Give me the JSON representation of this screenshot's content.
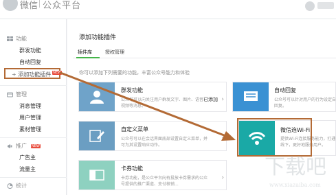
{
  "header": {
    "logo_text": "微信",
    "product": "公众平台"
  },
  "sidebar": {
    "sections": [
      {
        "heading": "功能",
        "icon": "function-grid-icon",
        "items": [
          "群发功能",
          "自动回复"
        ]
      },
      {
        "heading": "管理",
        "icon": "manage-icon",
        "items": [
          "消息管理",
          "用户管理",
          "素材管理"
        ]
      },
      {
        "heading": "推广",
        "icon": "promote-icon",
        "badge": "NEW",
        "items": [
          "广告主",
          "流量主"
        ]
      },
      {
        "heading": "统计",
        "icon": "stats-icon",
        "items": []
      }
    ],
    "add_plugin": {
      "label": "添加功能插件",
      "badge": "NEW"
    }
  },
  "main": {
    "title": "添加功能插件",
    "tabs": [
      {
        "label": "插件库",
        "active": true
      },
      {
        "label": "授权管理",
        "active": false
      }
    ],
    "intro": "你可以添加下列需要的功能，丰富公众号能力和体验",
    "cards_left": [
      {
        "title": "群发功能",
        "desc": "公众号可以向关注用户群发文字、图片、语音、视频等消息。",
        "status": "已添加",
        "color": "#6fa3c9",
        "icon": "users-icon"
      },
      {
        "title": "自定义菜单",
        "desc": "公众号可以在会话界面底部设置自定义菜单，并可为其设置响应动作。",
        "status": "",
        "color": "#6b9ec2",
        "icon": "menu-edit-icon"
      },
      {
        "title": "卡券功能",
        "desc": "卡券功能，是公众平台向有投放卡券需求的公众号提供的推广渠道、支付核销...",
        "status": "",
        "color": "#8ed1c0",
        "icon": "card-ticket-icon"
      }
    ],
    "cards_right": [
      {
        "title": "自动回复",
        "desc": "公众号可以针对用户的行为设定自动回复。",
        "color": "#3a91d3",
        "icon": "reply-icon"
      },
      {
        "title": "微信连Wi-Fi",
        "desc": "提供Wi-Fi连接服务能力，打通线上线下，更好地服务用户。",
        "color": "#1aa9a6",
        "icon": "wifi-icon"
      }
    ]
  },
  "watermark": {
    "cn": "下载吧",
    "en": "www.xiazaiba.com"
  },
  "colors": {
    "accent_green": "#44b549",
    "highlight_brown": "#b36a35"
  }
}
